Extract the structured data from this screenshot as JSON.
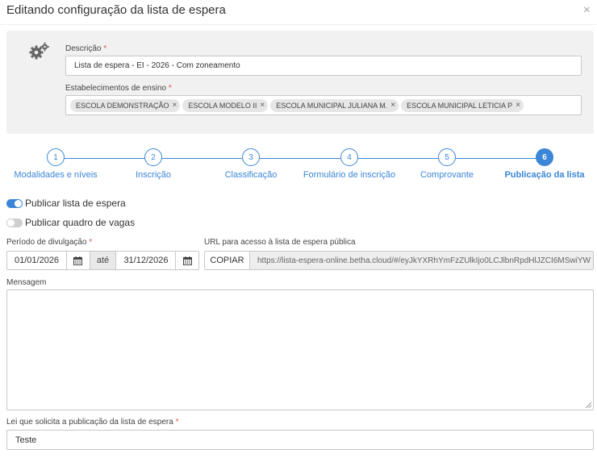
{
  "dialog": {
    "title": "Editando configuração da lista de espera",
    "close_label": "×"
  },
  "header_panel": {
    "icon": "gears-icon",
    "descricao_label": "Descrição",
    "descricao_value": "Lista de espera - EI - 2026 - Com zoneamento",
    "estabelecimentos_label": "Estabelecimentos de ensino",
    "required_mark": "*",
    "chips": [
      {
        "label": "ESCOLA DEMONSTRAÇÃO",
        "remove": "×"
      },
      {
        "label": "ESCOLA MODELO II",
        "remove": "×"
      },
      {
        "label": "ESCOLA MUNICIPAL JULIANA M.",
        "remove": "×"
      },
      {
        "label": "ESCOLA MUNICIPAL LETICIA P",
        "remove": "×"
      }
    ]
  },
  "stepper": {
    "active_step": 6,
    "accent": "#3b86d6",
    "steps": [
      {
        "num": "1",
        "label": "Modalidades e níveis"
      },
      {
        "num": "2",
        "label": "Inscrição"
      },
      {
        "num": "3",
        "label": "Classificação"
      },
      {
        "num": "4",
        "label": "Formulário de inscrição"
      },
      {
        "num": "5",
        "label": "Comprovante"
      },
      {
        "num": "6",
        "label": "Publicação da lista"
      }
    ]
  },
  "toggles": [
    {
      "label": "Publicar lista de espera",
      "on": true
    },
    {
      "label": "Publicar quadro de vagas",
      "on": false
    }
  ],
  "periodo": {
    "label": "Período de divulgação",
    "start": "01/01/2026",
    "separator": "até",
    "end": "31/12/2026",
    "calendar_icon": "calendar-icon"
  },
  "url": {
    "label": "URL para acesso à lista de espera pública",
    "copy_button": "COPIAR",
    "value": "https://lista-espera-online.betha.cloud/#/eyJkYXRhYmFzZUlkIjo0LCJlbnRpdHlJZCI6MSwiYW"
  },
  "mensagem": {
    "label": "Mensagem",
    "value": ""
  },
  "lei": {
    "label": "Lei que solicita a publicação da lista de espera",
    "value": "Teste"
  }
}
